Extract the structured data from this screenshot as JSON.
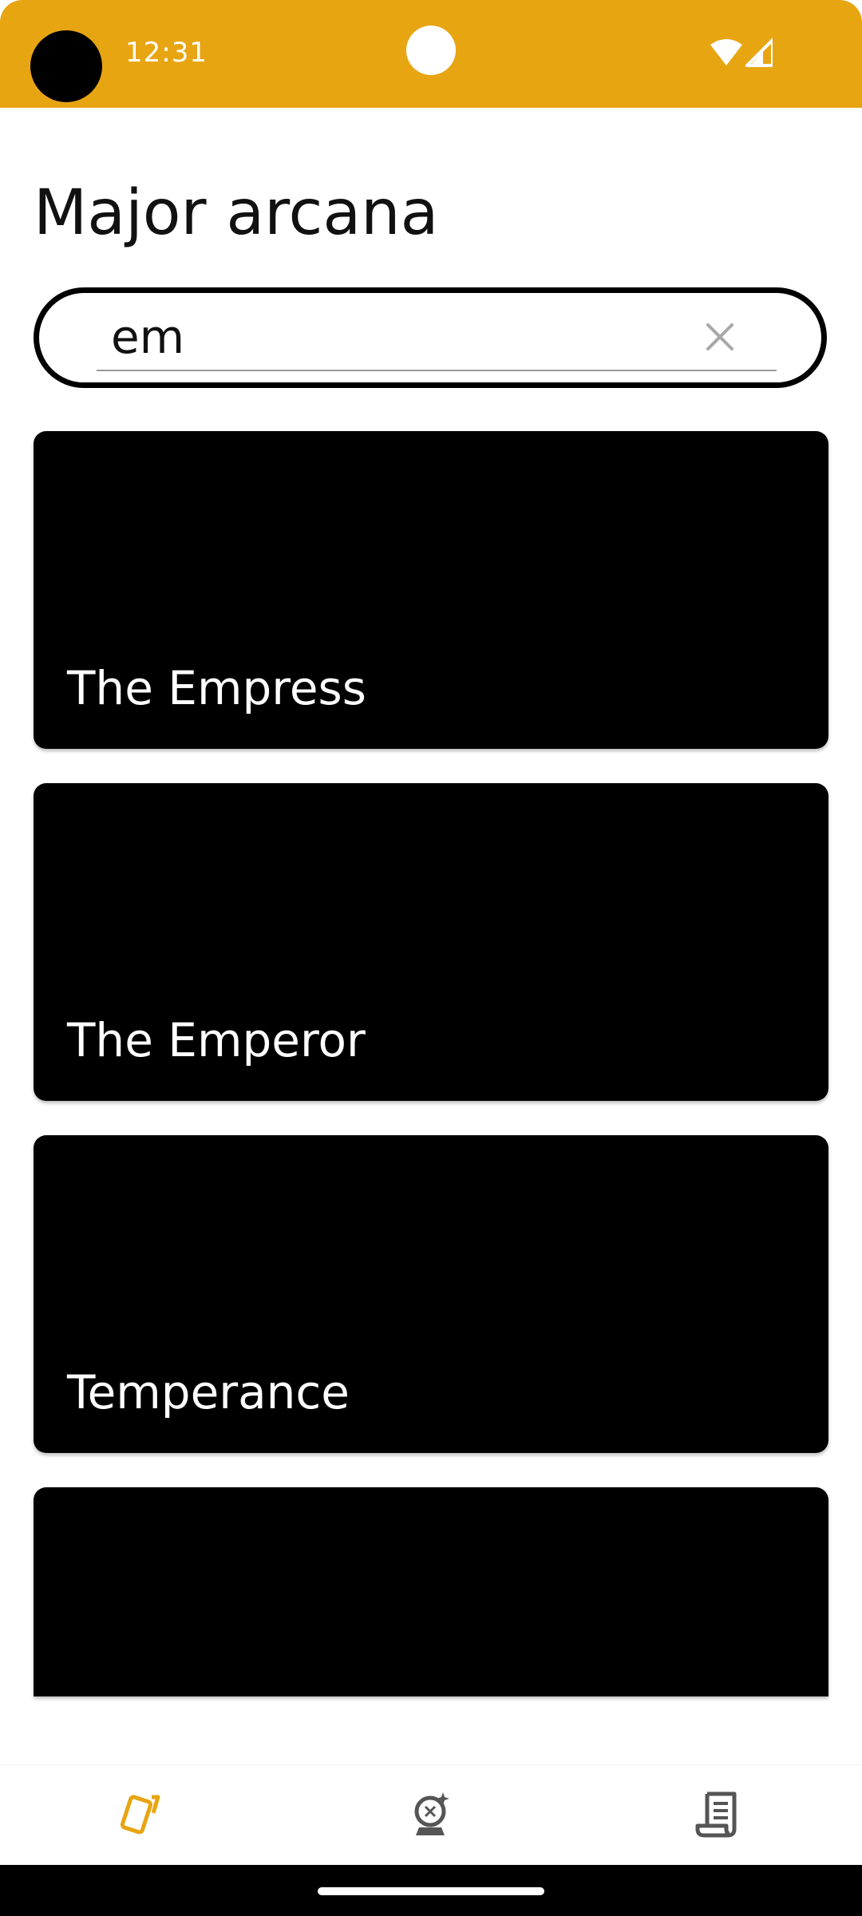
{
  "status_bar": {
    "time": "12:31",
    "background_color": "#E8A512"
  },
  "page": {
    "title": "Major arcana"
  },
  "search": {
    "value": "em",
    "clear_icon": "close-icon"
  },
  "results": [
    {
      "label": "The Empress"
    },
    {
      "label": "The Emperor"
    },
    {
      "label": "Temperance"
    },
    {
      "label": ""
    }
  ],
  "bottom_nav": {
    "items": [
      {
        "icon": "cards-icon",
        "active": true,
        "color": "#E8A512"
      },
      {
        "icon": "crystal-ball-icon",
        "active": false,
        "color": "#555555"
      },
      {
        "icon": "scroll-icon",
        "active": false,
        "color": "#555555"
      }
    ]
  }
}
